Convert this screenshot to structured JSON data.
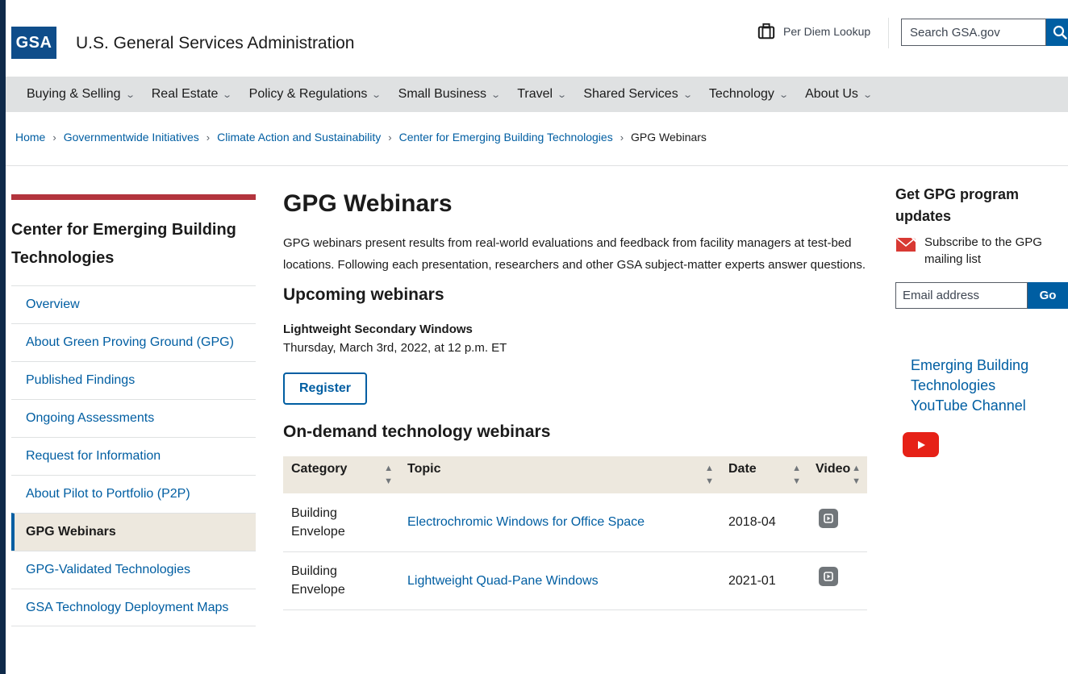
{
  "header": {
    "logo_text": "GSA",
    "site_name": "U.S. General Services Administration",
    "per_diem_label": "Per Diem Lookup",
    "search_placeholder": "Search GSA.gov"
  },
  "nav": {
    "items": [
      {
        "label": "Buying & Selling"
      },
      {
        "label": "Real Estate"
      },
      {
        "label": "Policy & Regulations"
      },
      {
        "label": "Small Business"
      },
      {
        "label": "Travel"
      },
      {
        "label": "Shared Services"
      },
      {
        "label": "Technology"
      },
      {
        "label": "About Us"
      }
    ]
  },
  "breadcrumb": {
    "items": [
      "Home",
      "Governmentwide Initiatives",
      "Climate Action and Sustainability",
      "Center for Emerging Building Technologies"
    ],
    "current": "GPG Webinars"
  },
  "sidebar": {
    "heading": "Center for Emerging Building Technologies",
    "items": [
      {
        "label": "Overview"
      },
      {
        "label": "About Green Proving Ground (GPG)"
      },
      {
        "label": "Published Findings"
      },
      {
        "label": "Ongoing Assessments"
      },
      {
        "label": "Request for Information"
      },
      {
        "label": "About Pilot to Portfolio (P2P)"
      },
      {
        "label": "GPG Webinars"
      },
      {
        "label": "GPG-Validated Technologies"
      },
      {
        "label": "GSA Technology Deployment Maps"
      }
    ],
    "active_index": 6
  },
  "main": {
    "title": "GPG Webinars",
    "intro": "GPG webinars present results from real-world evaluations and feedback from facility managers at test-bed locations. Following each presentation, researchers and other GSA subject-matter experts answer questions.",
    "upcoming_heading": "Upcoming webinars",
    "upcoming_title": "Lightweight Secondary Windows",
    "upcoming_date": "Thursday, March 3rd, 2022, at 12 p.m. ET",
    "register_label": "Register",
    "ondemand_heading": "On-demand technology webinars",
    "table": {
      "headers": [
        "Category",
        "Topic",
        "Date",
        "Video"
      ],
      "rows": [
        {
          "category": "Building Envelope",
          "topic": "Electrochromic Windows for Office Space",
          "date": "2018-04"
        },
        {
          "category": "Building Envelope",
          "topic": "Lightweight Quad-Pane Windows",
          "date": "2021-01"
        }
      ]
    }
  },
  "rail": {
    "title": "Get GPG program updates",
    "subscribe_text": "Subscribe to the GPG mailing list",
    "email_placeholder": "Email address",
    "go_label": "Go",
    "youtube_link": "Emerging Building Technologies YouTube Channel"
  },
  "colors": {
    "primary_blue": "#005ea2",
    "nav_bg": "#dfe1e2",
    "accent_red": "#b3343d",
    "table_header_bg": "#ede8de",
    "frame_bg": "#0f2a4a"
  }
}
